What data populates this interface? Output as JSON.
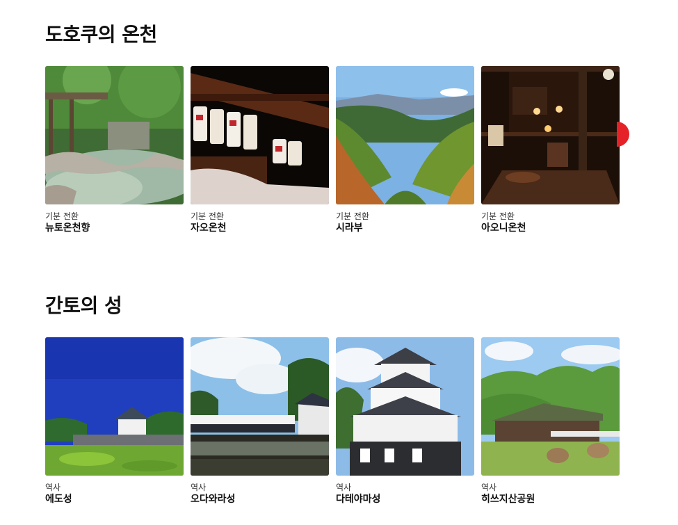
{
  "sections": [
    {
      "title": "도호쿠의 온천",
      "cards": [
        {
          "category": "기분 전환",
          "name": "뉴토온천향"
        },
        {
          "category": "기분 전환",
          "name": "자오온천"
        },
        {
          "category": "기분 전환",
          "name": "시라부"
        },
        {
          "category": "기분 전환",
          "name": "아오니온천"
        }
      ]
    },
    {
      "title": "간토의 성",
      "cards": [
        {
          "category": "역사",
          "name": "에도성"
        },
        {
          "category": "역사",
          "name": "오다와라성"
        },
        {
          "category": "역사",
          "name": "다테야마성"
        },
        {
          "category": "역사",
          "name": "히쓰지산공원"
        }
      ]
    }
  ],
  "carousel": {
    "next_icon": "chevron-right-icon",
    "accent": "#e52228"
  }
}
